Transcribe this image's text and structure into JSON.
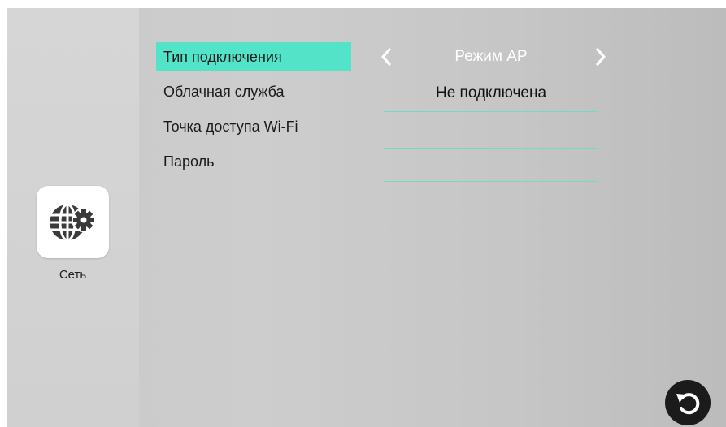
{
  "sidebar": {
    "app": {
      "label": "Сеть",
      "icon": "network-settings-icon"
    }
  },
  "menu": {
    "items": [
      {
        "label": "Тип подключения",
        "active": true
      },
      {
        "label": "Облачная служба",
        "active": false
      },
      {
        "label": "Точка доступа Wi-Fi",
        "active": false
      },
      {
        "label": "Пароль",
        "active": false
      }
    ]
  },
  "values": {
    "connection_type": "Режим AP",
    "cloud_service": "Не подключена",
    "wifi_access_point": "",
    "password": ""
  },
  "icons": {
    "prev": "chevron-left-icon",
    "next": "chevron-right-icon",
    "back": "back-icon"
  },
  "colors": {
    "accent": "#53e3c9",
    "divider": "#6fdcc6",
    "back_button": "#1b1b1b"
  }
}
